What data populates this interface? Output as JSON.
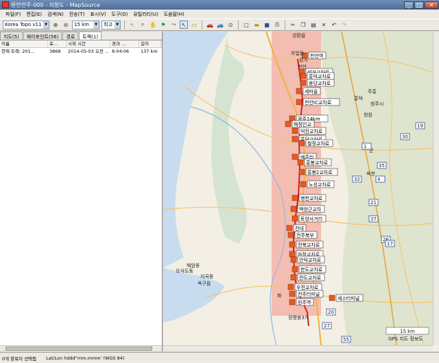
{
  "window": {
    "title": "완안전주-000 - 지형도 - MapSource",
    "minimize_glyph": "_",
    "maximize_glyph": "□",
    "close_glyph": "✕"
  },
  "menu": [
    "파일(F)",
    "편집(E)",
    "검색(N)",
    "전송(T)",
    "표시(V)",
    "도구(O)",
    "유틸리티(U)",
    "도움말(H)"
  ],
  "toolbar": {
    "map_product": "Korea Topo v11",
    "zoom_scale": "15 km",
    "detail": "최고",
    "zoom_in_glyph": "🔍",
    "zoom_out_glyph": "🔍",
    "tools": [
      "selection-tool-icon",
      "zoom-tool-icon",
      "hand-tool-icon",
      "waypoint-tool-icon",
      "route-tool-icon",
      "select-arrow-icon",
      "measure-tool-icon",
      "car-icon",
      "car-route-icon",
      "find-icon"
    ],
    "file_tools": [
      "new-icon",
      "open-icon",
      "save-icon",
      "print-icon",
      "cut-icon",
      "copy-icon",
      "paste-icon",
      "delete-icon",
      "undo-icon",
      "redo-icon"
    ]
  },
  "tabs": [
    "지도(5)",
    "웨이포인트(56)",
    "경로",
    "트랙(1)"
  ],
  "active_tab": 3,
  "track_list": {
    "columns": [
      "이름",
      "포...",
      "시작 시간",
      "경과 ...",
      "길이"
    ],
    "rows": [
      [
        "현재 트랙: 201...",
        "3868",
        "2014-05-03 오전 ...",
        "8:04:06",
        "137 km"
      ]
    ]
  },
  "map": {
    "places": [
      {
        "name": "성환읍"
      },
      {
        "name": "자업동"
      },
      {
        "name": "성거"
      },
      {
        "name": "천안"
      },
      {
        "name": "흥덕"
      },
      {
        "name": "주흥"
      },
      {
        "name": "청주시"
      },
      {
        "name": "청원"
      },
      {
        "name": "옥천"
      },
      {
        "name": "해암동"
      },
      {
        "name": "오식도동"
      },
      {
        "name": "지곡동"
      },
      {
        "name": "옥구읍"
      },
      {
        "name": "화"
      },
      {
        "name": "정평용3가"
      },
      {
        "name": "군"
      }
    ],
    "waypoint_labels": [
      "천안역",
      "성거교차로",
      "흥덕교차로",
      "용당교차로",
      "세마을",
      "천안IC교차로",
      "광주14km",
      "해정인교",
      "덕진교차로",
      "흥덕교차로",
      "철정교차로",
      "예흔리",
      "흥봉교차로",
      "흥봉2교차로",
      "노성교차로",
      "행천교차로",
      "백양근교차",
      "토양사거리",
      "전대",
      "전주북부",
      "전북교차로",
      "마정교차로",
      "안덕교차로",
      "한도교차로",
      "전도교차로",
      "우전교차로",
      "전주터미널",
      "원주역",
      "세스터미널"
    ],
    "road_shields": [
      "19",
      "30",
      "1",
      "35",
      "4",
      "32",
      "21",
      "37",
      "26",
      "17",
      "27",
      "20",
      "55"
    ],
    "scale_bar": "15 km",
    "credit": "GPS 지도 정보도"
  },
  "status": {
    "selection": "0개 항목이 선택됨",
    "coord_format": "Lat/Lon hddd°mm.mmm' (WGS 84)"
  }
}
